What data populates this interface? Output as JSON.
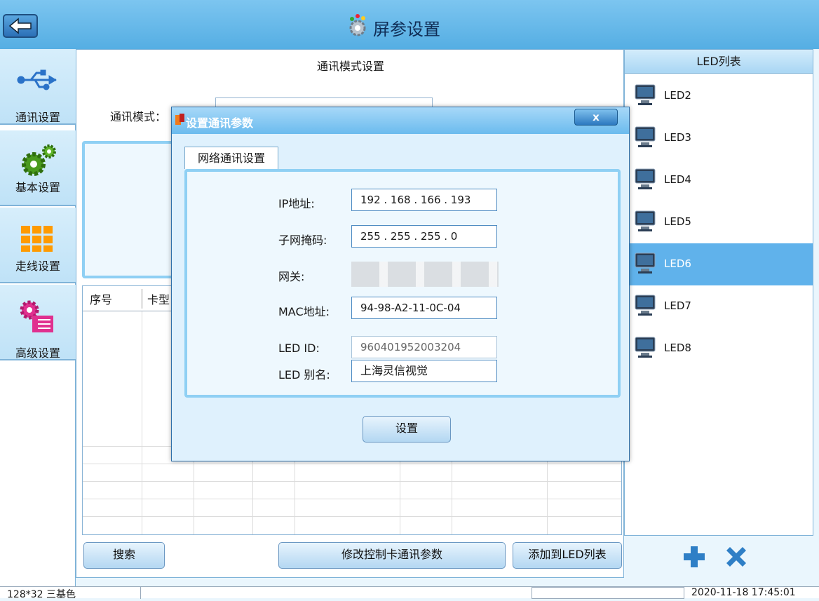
{
  "title": "屏参设置",
  "nav": [
    {
      "label": "通讯设置",
      "icon": "usb-icon"
    },
    {
      "label": "基本设置",
      "icon": "gears-icon"
    },
    {
      "label": "走线设置",
      "icon": "grid-icon"
    },
    {
      "label": "高级设置",
      "icon": "advanced-settings-icon"
    }
  ],
  "main": {
    "title": "通讯模式设置",
    "mode_label": "通讯模式：",
    "table_headers": [
      "序号",
      "卡型"
    ],
    "buttons": {
      "search": "搜索",
      "modify": "修改控制卡通讯参数",
      "add_to_list": "添加到LED列表"
    }
  },
  "led_list": {
    "header": "LED列表",
    "items": [
      "LED2",
      "LED3",
      "LED4",
      "LED5",
      "LED6",
      "LED7",
      "LED8"
    ],
    "selected": "LED6"
  },
  "dialog": {
    "title": "设置通讯参数",
    "close_label": "x",
    "tab": "网络通讯设置",
    "fields": {
      "ip_label": "IP地址:",
      "ip_value": "192 . 168 . 166 . 193",
      "mask_label": "子网掩码:",
      "mask_value": "255 . 255 . 255 .  0",
      "gateway_label": "网关:",
      "mac_label": "MAC地址:",
      "mac_value": "94-98-A2-11-0C-04",
      "ledid_label": "LED ID:",
      "ledid_value": "960401952003204",
      "alias_label": "LED 别名:",
      "alias_value": "上海灵信视觉"
    },
    "set_button": "设置"
  },
  "status": {
    "left": "128*32 三基色",
    "right": "2020-11-18 17:45:01"
  }
}
